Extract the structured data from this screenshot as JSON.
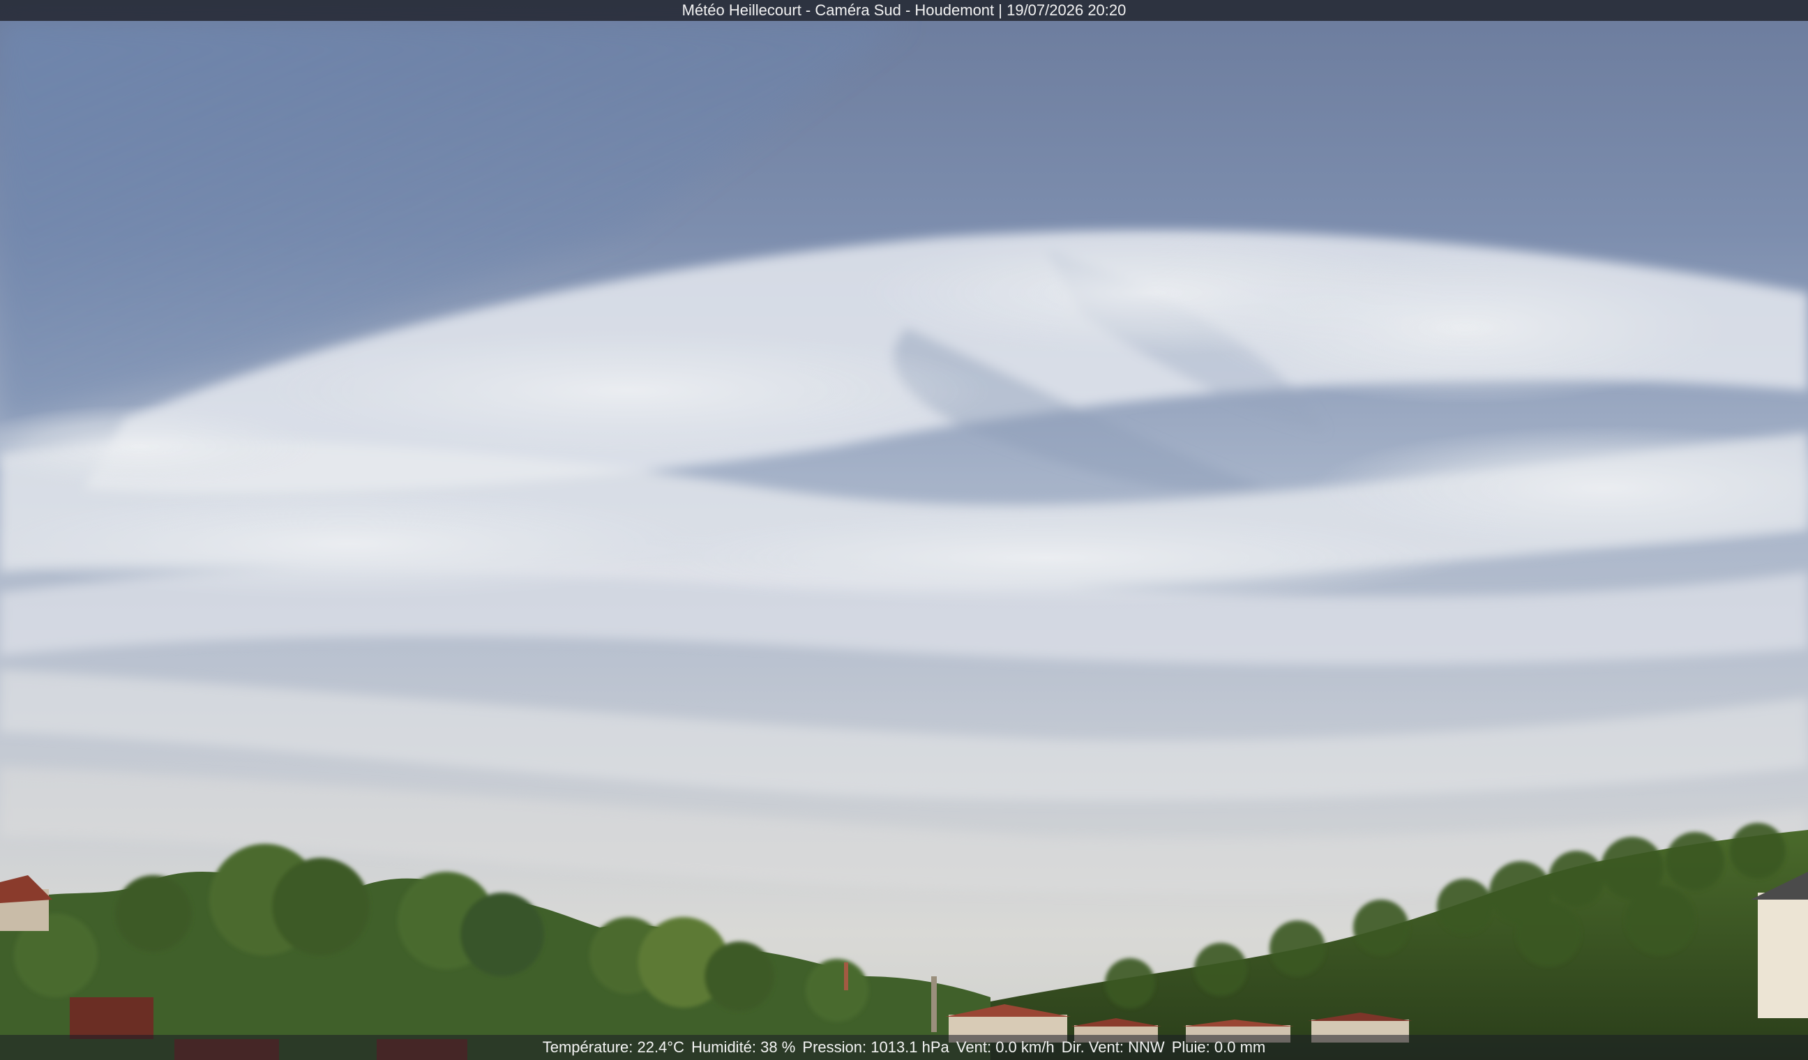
{
  "camera": {
    "title": "Météo Heillecourt - Caméra Sud - Houdemont | 19/07/2026 20:20"
  },
  "weather": {
    "temperature": "Température: 22.4°C",
    "humidity": "Humidité: 38 %",
    "pressure": "Pression: 1013.1 hPa",
    "wind": "Vent: 0.0 km/h",
    "wind_direction": "Dir. Vent: NNW",
    "rain": "Pluie: 0.0 mm"
  },
  "colors": {
    "sky_top": "#6e7e9f",
    "sky_horizon": "#d2d4d6",
    "cloud": "#e6e9ee",
    "foliage": "#3f5a26",
    "roof": "#8a3b2c"
  }
}
